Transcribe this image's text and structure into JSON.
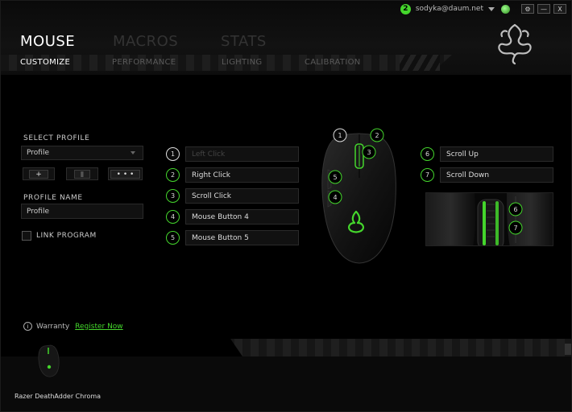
{
  "topbar": {
    "notification_count": "2",
    "account_email": "sodyka@daum.net",
    "settings_label": "⚙",
    "minimize_label": "—",
    "close_label": "X"
  },
  "main_tabs": [
    {
      "label": "MOUSE",
      "active": true
    },
    {
      "label": "MACROS",
      "active": false
    },
    {
      "label": "STATS",
      "active": false
    }
  ],
  "sub_tabs": [
    {
      "label": "CUSTOMIZE",
      "active": true
    },
    {
      "label": "PERFORMANCE",
      "active": false
    },
    {
      "label": "LIGHTING",
      "active": false
    },
    {
      "label": "CALIBRATION",
      "active": false
    }
  ],
  "profile": {
    "select_label": "SELECT PROFILE",
    "selected": "Profile",
    "add_label": "+",
    "delete_label": "▮",
    "more_label": "• • •",
    "name_label": "PROFILE NAME",
    "name_value": "Profile",
    "link_program_label": "LINK PROGRAM",
    "link_program_checked": false
  },
  "buttons_left": [
    {
      "num": "1",
      "label": "Left Click",
      "disabled": true
    },
    {
      "num": "2",
      "label": "Right Click",
      "disabled": false
    },
    {
      "num": "3",
      "label": "Scroll Click",
      "disabled": false
    },
    {
      "num": "4",
      "label": "Mouse Button 4",
      "disabled": false
    },
    {
      "num": "5",
      "label": "Mouse Button 5",
      "disabled": false
    }
  ],
  "buttons_right": [
    {
      "num": "6",
      "label": "Scroll Up"
    },
    {
      "num": "7",
      "label": "Scroll Down"
    }
  ],
  "mouse_callouts": [
    "1",
    "2",
    "3",
    "5",
    "4"
  ],
  "wheel_callouts": [
    "6",
    "7"
  ],
  "footer": {
    "warranty_label": "Warranty",
    "register_label": "Register Now",
    "device_name": "Razer DeathAdder Chroma"
  },
  "colors": {
    "accent": "#44d62c",
    "background": "#000000"
  }
}
